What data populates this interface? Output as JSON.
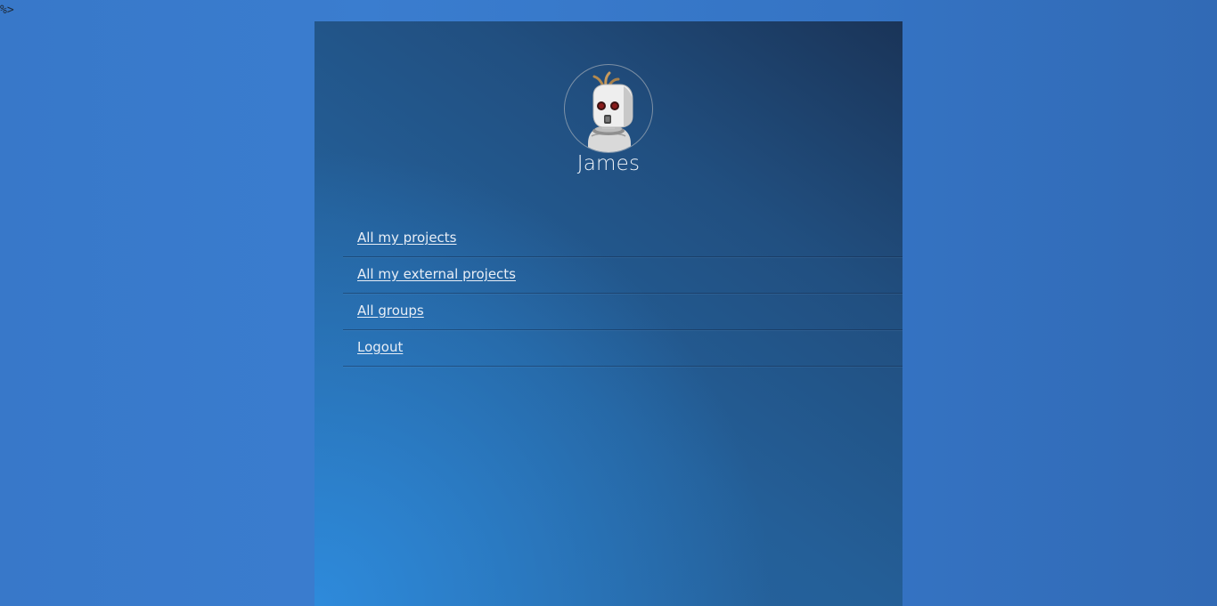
{
  "stray_text": "%>",
  "profile": {
    "name": "James",
    "avatar_icon": "robot-avatar-icon"
  },
  "menu": {
    "items": [
      {
        "label": "All my projects"
      },
      {
        "label": "All my external projects"
      },
      {
        "label": "All groups"
      },
      {
        "label": "Logout"
      }
    ]
  },
  "colors": {
    "page_background": "#3a7dcf",
    "panel_dark": "#1a3458",
    "panel_light": "#2e8cde",
    "link_text": "#e8eef6"
  }
}
